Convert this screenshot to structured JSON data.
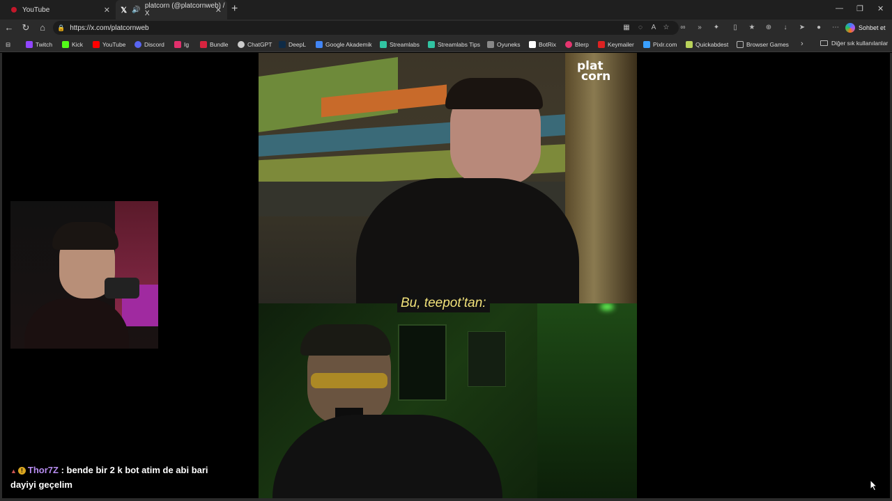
{
  "tabs": [
    {
      "title": "YouTube",
      "icon": "youtube-icon"
    },
    {
      "title": "platcorn (@platcornweb) / X",
      "icon": "x-icon"
    }
  ],
  "address": {
    "url": "https://x.com/platcornweb",
    "sohbet": "Sohbet et"
  },
  "bookmarks": [
    {
      "label": "Twitch",
      "color": "#9146ff"
    },
    {
      "label": "Kick",
      "color": "#53fc18"
    },
    {
      "label": "YouTube",
      "color": "#ff0000"
    },
    {
      "label": "Discord",
      "color": "#5865f2"
    },
    {
      "label": "Ig",
      "color": "#e1306c"
    },
    {
      "label": "Bundle",
      "color": "#d9243f"
    },
    {
      "label": "ChatGPT",
      "color": "#cccccc"
    },
    {
      "label": "DeepL",
      "color": "#0f2b46"
    },
    {
      "label": "Google Akademik",
      "color": "#4285f4"
    },
    {
      "label": "Streamlabs",
      "color": "#31c3a2"
    },
    {
      "label": "Streamlabs Tips",
      "color": "#31c3a2"
    },
    {
      "label": "Oyuneks",
      "color": "#888888"
    },
    {
      "label": "BotRix",
      "color": "#ffffff"
    },
    {
      "label": "Blerp",
      "color": "#e5356f"
    },
    {
      "label": "Keymailer",
      "color": "#d22"
    },
    {
      "label": "Pixlr.com",
      "color": "#3aa0ff"
    },
    {
      "label": "Quickabdest",
      "color": "#b8d25a"
    },
    {
      "label": "Browser Games",
      "color": "#bbbbbb"
    }
  ],
  "bookmarks_folder": "Diğer sık kullanılanlar",
  "video": {
    "logo_line1": "plat",
    "logo_line2": "corn",
    "subtitle": "Bu, teepot’tan:"
  },
  "chat": {
    "username": "Thor7Z",
    "separator": " : ",
    "message": "bende bir 2 k bot atim de abi bari dayiyi geçelim"
  }
}
